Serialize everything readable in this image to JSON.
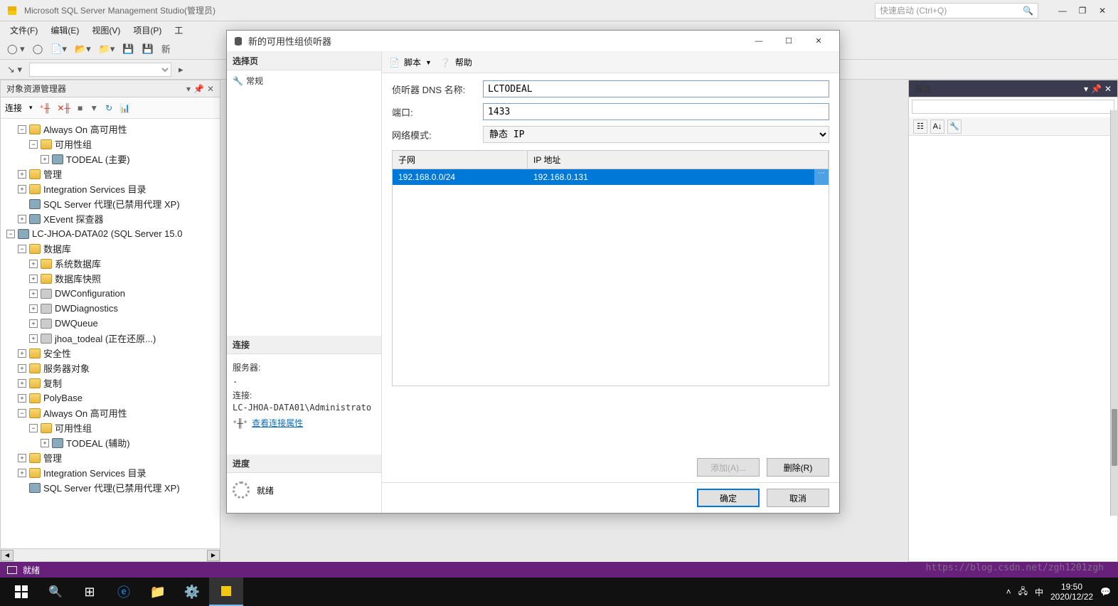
{
  "titlebar": {
    "app_title": "Microsoft SQL Server Management Studio(管理员)",
    "quick_launch_placeholder": "快速启动 (Ctrl+Q)"
  },
  "menu": {
    "file": "文件(F)",
    "edit": "编辑(E)",
    "view": "视图(V)",
    "project": "项目(P)",
    "tools": "工",
    "new_prefix": "新"
  },
  "object_explorer": {
    "title": "对象资源管理器",
    "connect_label": "连接",
    "nodes": [
      {
        "depth": 1,
        "exp": "−",
        "icon": "folder",
        "label": "Always On 高可用性"
      },
      {
        "depth": 2,
        "exp": "−",
        "icon": "folder",
        "label": "可用性组"
      },
      {
        "depth": 3,
        "exp": "+",
        "icon": "srv",
        "label": "TODEAL (主要)"
      },
      {
        "depth": 1,
        "exp": "+",
        "icon": "folder",
        "label": "管理"
      },
      {
        "depth": 1,
        "exp": "+",
        "icon": "folder",
        "label": "Integration Services 目录"
      },
      {
        "depth": 1,
        "exp": "",
        "icon": "srv",
        "label": "SQL Server 代理(已禁用代理 XP)"
      },
      {
        "depth": 1,
        "exp": "+",
        "icon": "srv",
        "label": "XEvent 探查器"
      },
      {
        "depth": 0,
        "exp": "−",
        "icon": "srv",
        "label": "LC-JHOA-DATA02 (SQL Server 15.0"
      },
      {
        "depth": 1,
        "exp": "−",
        "icon": "folder",
        "label": "数据库"
      },
      {
        "depth": 2,
        "exp": "+",
        "icon": "folder",
        "label": "系统数据库"
      },
      {
        "depth": 2,
        "exp": "+",
        "icon": "folder",
        "label": "数据库快照"
      },
      {
        "depth": 2,
        "exp": "+",
        "icon": "db",
        "label": "DWConfiguration"
      },
      {
        "depth": 2,
        "exp": "+",
        "icon": "db",
        "label": "DWDiagnostics"
      },
      {
        "depth": 2,
        "exp": "+",
        "icon": "db",
        "label": "DWQueue"
      },
      {
        "depth": 2,
        "exp": "+",
        "icon": "db",
        "label": "jhoa_todeal (正在还原...)"
      },
      {
        "depth": 1,
        "exp": "+",
        "icon": "folder",
        "label": "安全性"
      },
      {
        "depth": 1,
        "exp": "+",
        "icon": "folder",
        "label": "服务器对象"
      },
      {
        "depth": 1,
        "exp": "+",
        "icon": "folder",
        "label": "复制"
      },
      {
        "depth": 1,
        "exp": "+",
        "icon": "folder",
        "label": "PolyBase"
      },
      {
        "depth": 1,
        "exp": "−",
        "icon": "folder",
        "label": "Always On 高可用性"
      },
      {
        "depth": 2,
        "exp": "−",
        "icon": "folder",
        "label": "可用性组"
      },
      {
        "depth": 3,
        "exp": "+",
        "icon": "srv",
        "label": "TODEAL (辅助)"
      },
      {
        "depth": 1,
        "exp": "+",
        "icon": "folder",
        "label": "管理"
      },
      {
        "depth": 1,
        "exp": "+",
        "icon": "folder",
        "label": "Integration Services 目录"
      },
      {
        "depth": 1,
        "exp": "",
        "icon": "srv",
        "label": "SQL Server 代理(已禁用代理 XP)"
      }
    ]
  },
  "properties": {
    "title": "属性"
  },
  "statusbar": {
    "text": "就绪"
  },
  "taskbar": {
    "time": "19:50",
    "date": "2020/12/22",
    "ime": "中"
  },
  "dialog": {
    "title": "新的可用性组侦听器",
    "select_page": "选择页",
    "general": "常规",
    "script": "脚本",
    "help": "帮助",
    "dns_label": "侦听器 DNS 名称:",
    "dns_value": "LCTODEAL",
    "port_label": "端口:",
    "port_value": "1433",
    "netmode_label": "网络模式:",
    "netmode_value": "静态 IP",
    "col_subnet": "子网",
    "col_ip": "IP 地址",
    "row_subnet": "192.168.0.0/24",
    "row_ip": "192.168.0.131",
    "connection_hdr": "连接",
    "server_label": "服务器:",
    "server_value": ".",
    "conn_label": "连接:",
    "conn_value": "LC-JHOA-DATA01\\Administrato",
    "view_conn": "查看连接属性",
    "progress_hdr": "进度",
    "progress_status": "就绪",
    "add_btn": "添加(A)...",
    "remove_btn": "删除(R)",
    "ok_btn": "确定",
    "cancel_btn": "取消"
  },
  "watermark": "https://blog.csdn.net/zgh1201zgh"
}
